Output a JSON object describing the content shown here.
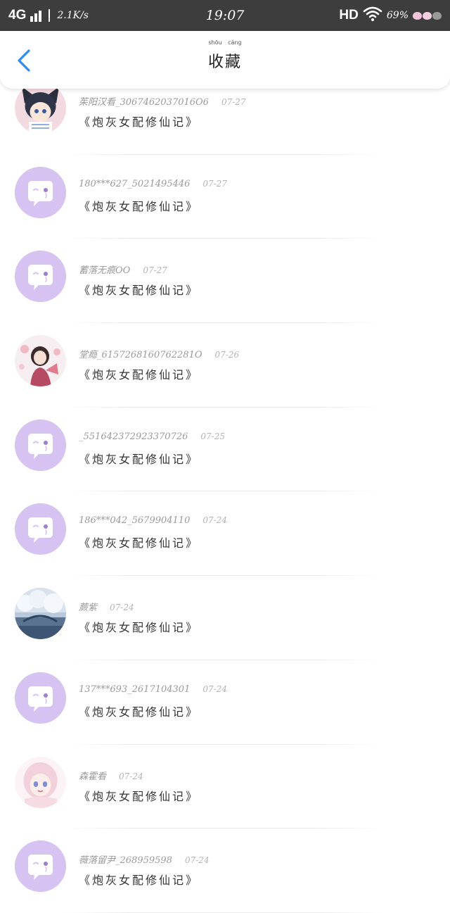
{
  "status_bar": {
    "network": "4G",
    "speed": "2.1K/s",
    "time": "19:07",
    "hd": "HD",
    "battery": "69%"
  },
  "header": {
    "title": "收藏",
    "title_pinyin": "shōu cáng",
    "back_icon": "chevron-left-icon"
  },
  "colors": {
    "status_bar_bg": "#3d3d3d",
    "accent_blue": "#2d8cf0",
    "default_avatar": "#d6c3f2"
  },
  "items": [
    {
      "user": "茱阳汉看_3067462037016O6",
      "date": "07-27",
      "title": "《炮灰女配修仙记》",
      "avatar": "boy-cat-ears"
    },
    {
      "user": "180***627_5021495446",
      "date": "07-27",
      "title": "《炮灰女配修仙记》",
      "avatar": "default"
    },
    {
      "user": "蓄落无痕OO",
      "date": "07-27",
      "title": "《炮灰女配修仙记》",
      "avatar": "default"
    },
    {
      "user": "堂瘾_6157268160762281O",
      "date": "07-26",
      "title": "《炮灰女配修仙记》",
      "avatar": "girl-pink"
    },
    {
      "user": "_551642372923370726",
      "date": "07-25",
      "title": "《炮灰女配修仙记》",
      "avatar": "default"
    },
    {
      "user": "186***042_5679904110",
      "date": "07-24",
      "title": "《炮灰女配修仙记》",
      "avatar": "default"
    },
    {
      "user": "蕨紫",
      "date": "07-24",
      "title": "《炮灰女配修仙记》",
      "avatar": "snow-scene"
    },
    {
      "user": "137***693_2617104301",
      "date": "07-24",
      "title": "《炮灰女配修仙记》",
      "avatar": "default"
    },
    {
      "user": "森霍看",
      "date": "07-24",
      "title": "《炮灰女配修仙记》",
      "avatar": "anime-girl"
    },
    {
      "user": "薇落留尹_268959598",
      "date": "07-24",
      "title": "《炮灰女配修仙记》",
      "avatar": "default"
    }
  ]
}
